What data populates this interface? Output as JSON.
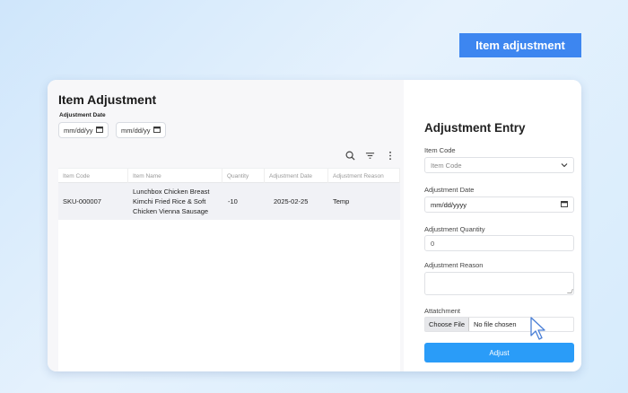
{
  "corner_tag": "Item adjustment",
  "page": {
    "title": "Item Adjustment",
    "filter_label": "Adjustment Date",
    "date_from": "mm/dd/yy",
    "date_to": "mm/dd/yy"
  },
  "toolbar_icons": [
    "search-icon",
    "filter-icon",
    "more-vertical-icon"
  ],
  "table": {
    "columns": [
      "Item Code",
      "Item Name",
      "Quantity",
      "Adjustment Date",
      "Adjustment Reason"
    ],
    "rows": [
      {
        "item_code": "SKU-000007",
        "item_name_lines": [
          "Lunchbox Chicken Breast",
          "Kimchi Fried Rice & Soft",
          "Chicken Vienna Sausage"
        ],
        "quantity": "-10",
        "adjustment_date": "2025-02-25",
        "adjustment_reason": "Temp"
      }
    ]
  },
  "entry": {
    "title": "Adjustment Entry",
    "item_code_label": "Item Code",
    "item_code_placeholder": "Item Code",
    "date_label": "Adjustment Date",
    "date_placeholder": "mm/dd/yyyy",
    "quantity_label": "Adjustment Quantity",
    "quantity_value": "0",
    "reason_label": "Adjustment Reason",
    "attachment_label": "Attatchment",
    "choose_file_label": "Choose File",
    "file_status": "No file chosen",
    "submit_label": "Adjust"
  },
  "colors": {
    "accent": "#2a9cf8",
    "tag": "#3d86f0"
  }
}
